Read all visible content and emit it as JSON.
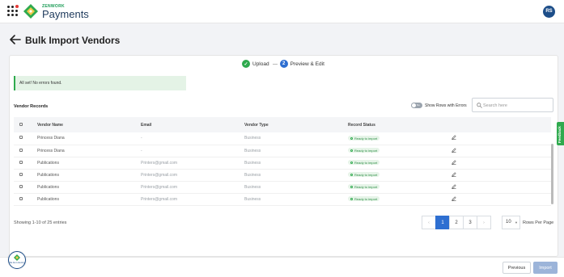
{
  "header": {
    "brand_small": "ZENWORK",
    "brand_big": "Payments",
    "avatar_initials": "RS",
    "brand_colors": {
      "green": "#2faa4e",
      "navy": "#1e3a5c",
      "blue": "#1d4e89"
    }
  },
  "page": {
    "title": "Bulk Import Vendors"
  },
  "stepper": {
    "steps": [
      {
        "number": "",
        "label": "Upload",
        "state": "done"
      },
      {
        "number": "2",
        "label": "Preview & Edit",
        "state": "active"
      }
    ]
  },
  "alert": {
    "message": "All set! No errors found."
  },
  "records": {
    "title": "Vendor Records",
    "toggle_label": "Show Rows with Errors",
    "toggle_text": "No",
    "search_placeholder": "Search here"
  },
  "table": {
    "columns": [
      "Vendor Name",
      "Email",
      "Vendor Type",
      "Record Status"
    ],
    "rows": [
      {
        "name": "Princess Diana",
        "email": "-",
        "type": "Business",
        "status": "Ready to import"
      },
      {
        "name": "Princess Diana",
        "email": "-",
        "type": "Business",
        "status": "Ready to import"
      },
      {
        "name": "Publications",
        "email": "Printers@gmail.com",
        "type": "Business",
        "status": "Ready to import"
      },
      {
        "name": "Publications",
        "email": "Printers@gmail.com",
        "type": "Business",
        "status": "Ready to import"
      },
      {
        "name": "Publications",
        "email": "Printers@gmail.com",
        "type": "Business",
        "status": "Ready to import"
      },
      {
        "name": "Publications",
        "email": "Printers@gmail.com",
        "type": "Business",
        "status": "Ready to import"
      }
    ]
  },
  "pagination": {
    "showing_text": "Showing 1-10 of 25 entries",
    "prev_symbol": "‹",
    "next_symbol": "›",
    "pages": [
      "1",
      "2",
      "3"
    ],
    "active_page": "1",
    "per_page": "10",
    "per_page_label": "Rows Per Page"
  },
  "feedback_label": "Feedback",
  "footer": {
    "previous_label": "Previous",
    "import_label": "Import"
  },
  "help_badge": {
    "text": "We Are Listening"
  }
}
